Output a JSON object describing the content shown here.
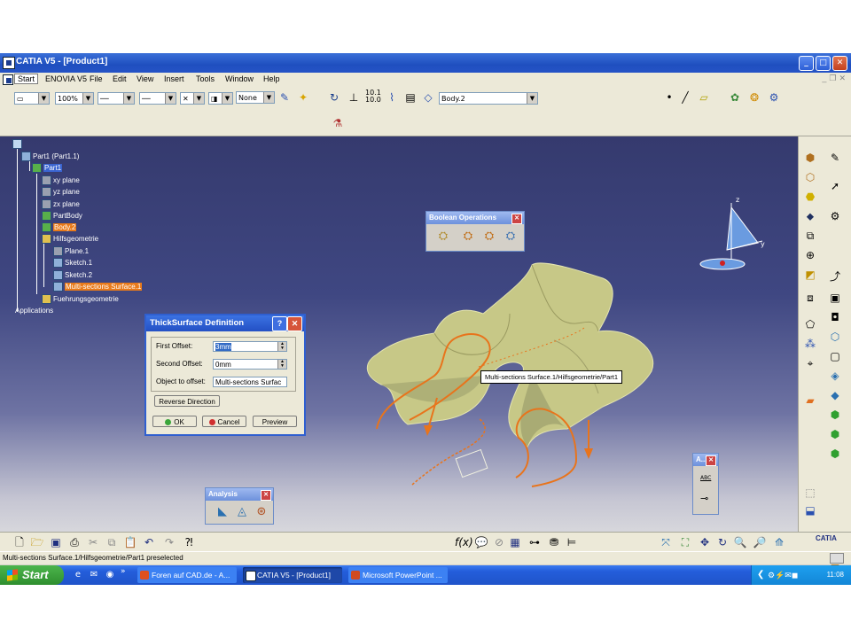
{
  "window": {
    "title": "CATIA V5 - [Product1]"
  },
  "menu": [
    "Start",
    "ENOVIA V5",
    "File",
    "Edit",
    "View",
    "Insert",
    "Tools",
    "Window",
    "Help"
  ],
  "toolbar": {
    "zoom": "100%",
    "layer": "None",
    "body": "Body.2"
  },
  "tree": {
    "root": "Part1 (Part1.1)",
    "part": "Part1",
    "xy": "xy plane",
    "yz": "yz plane",
    "zx": "zx plane",
    "partbody": "PartBody",
    "body2": "Body.2",
    "hilfs": "Hilfsgeometrie",
    "plane1": "Plane.1",
    "sketch1": "Sketch.1",
    "sketch2": "Sketch.2",
    "mss": "Multi-sections Surface.1",
    "fuehr": "Fuehrungsgeometrie",
    "apps": "Applications"
  },
  "boolean": {
    "title": "Boolean Operations"
  },
  "analysis": {
    "title": "Analysis"
  },
  "small_panel": {
    "title": "A...",
    "label": "ABC"
  },
  "dialog": {
    "title": "ThickSurface Definition",
    "first_label": "First Offset:",
    "first_value": "3mm",
    "second_label": "Second Offset:",
    "second_value": "0mm",
    "object_label": "Object to offset:",
    "object_value": "Multi-sections Surfac",
    "reverse": "Reverse Direction",
    "ok": "OK",
    "cancel": "Cancel",
    "preview": "Preview"
  },
  "tooltip": "Multi-sections Surface.1/Hilfsgeometrie/Part1",
  "compass": {
    "x": "x",
    "y": "y",
    "z": "z"
  },
  "status": {
    "text": "Multi-sections Surface.1/Hilfsgeometrie/Part1 preselected"
  },
  "taskbar": {
    "start": "Start",
    "tasks": [
      "Foren auf CAD.de - A...",
      "CATIA V5 - [Product1]",
      "Microsoft PowerPoint ..."
    ],
    "lang": "DE",
    "time": "11:08"
  },
  "logo": "CATIA",
  "colors": {
    "titlebar": "#2553c6",
    "viewport_top": "#353a6e",
    "highlight": "#e87a1a",
    "surface": "#c7c887",
    "curve": "#e8741c"
  }
}
